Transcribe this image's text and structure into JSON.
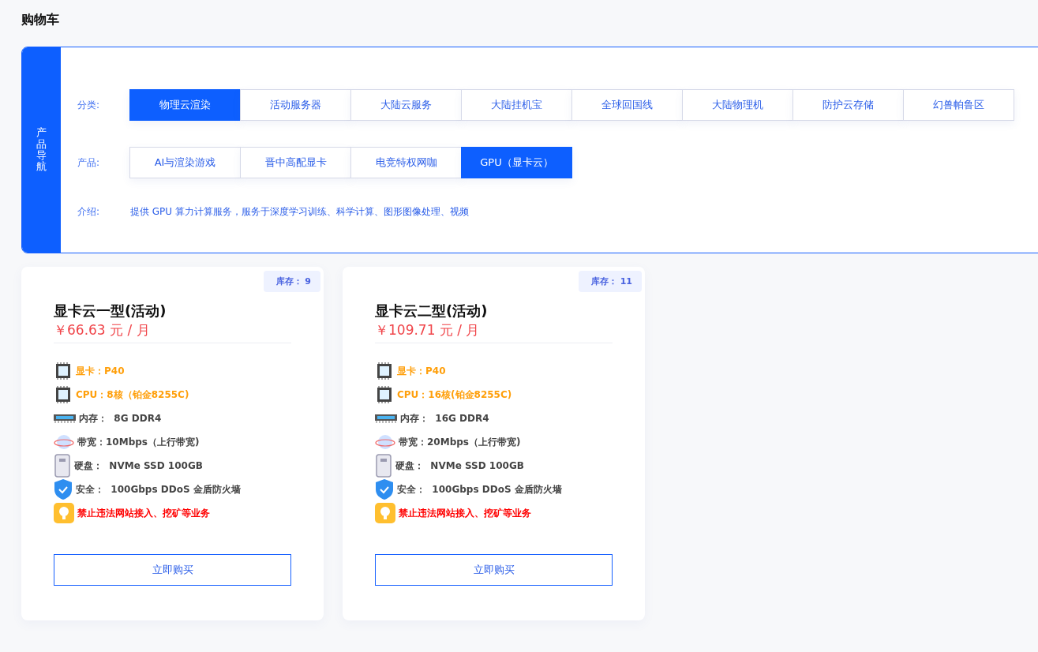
{
  "page_title": "购物车",
  "nav": {
    "side_label": "产品导航",
    "category_label": "分类:",
    "categories": [
      {
        "label": "物理云渲染",
        "selected": true
      },
      {
        "label": "活动服务器",
        "selected": false
      },
      {
        "label": "大陆云服务",
        "selected": false
      },
      {
        "label": "大陆挂机宝",
        "selected": false
      },
      {
        "label": "全球回国线",
        "selected": false
      },
      {
        "label": "大陆物理机",
        "selected": false
      },
      {
        "label": "防护云存储",
        "selected": false
      },
      {
        "label": "幻兽帕鲁区",
        "selected": false
      }
    ],
    "product_label": "产品:",
    "products": [
      {
        "label": "AI与渲染游戏",
        "selected": false
      },
      {
        "label": "晋中高配显卡",
        "selected": false
      },
      {
        "label": "电竞特权网咖",
        "selected": false
      },
      {
        "label": "GPU（显卡云）",
        "selected": true
      }
    ],
    "intro_label": "介绍:",
    "intro": "提供 GPU 算力计算服务，服务于深度学习训练、科学计算、图形图像处理、视频"
  },
  "cards": [
    {
      "stock": "库存： 9",
      "name": "显卡云一型(活动)",
      "price": "￥66.63 元 / 月",
      "specs": [
        {
          "kind": "chip",
          "color": "#ff9f0a",
          "text": "显卡：P40"
        },
        {
          "kind": "chip",
          "color": "#ff9f0a",
          "text": "CPU：8核（铂金8255C)"
        },
        {
          "kind": "ram",
          "color": "#444444",
          "text": "内存：  8G DDR4"
        },
        {
          "kind": "globe",
          "color": "#444444",
          "text": "带宽：10Mbps（上行带宽)"
        },
        {
          "kind": "disk",
          "color": "#444444",
          "text": "硬盘：  NVMe SSD 100GB"
        },
        {
          "kind": "shield",
          "color": "#444444",
          "text": "安全：  100Gbps DDoS 金盾防火墙"
        },
        {
          "kind": "bulb",
          "color": "#ff0000",
          "text": "禁止违法网站接入、挖矿等业务"
        }
      ],
      "buy": "立即购买"
    },
    {
      "stock": "库存： 11",
      "name": "显卡云二型(活动)",
      "price": "￥109.71 元 / 月",
      "specs": [
        {
          "kind": "chip",
          "color": "#ff9f0a",
          "text": "显卡：P40"
        },
        {
          "kind": "chip",
          "color": "#ff9f0a",
          "text": "CPU：16核(铂金8255C)"
        },
        {
          "kind": "ram",
          "color": "#444444",
          "text": "内存：  16G DDR4"
        },
        {
          "kind": "globe",
          "color": "#444444",
          "text": "带宽：20Mbps（上行带宽)"
        },
        {
          "kind": "disk",
          "color": "#444444",
          "text": "硬盘：  NVMe SSD 100GB"
        },
        {
          "kind": "shield",
          "color": "#444444",
          "text": "安全：  100Gbps DDoS 金盾防火墙"
        },
        {
          "kind": "bulb",
          "color": "#ff0000",
          "text": "禁止违法网站接入、挖矿等业务"
        }
      ],
      "buy": "立即购买"
    }
  ]
}
